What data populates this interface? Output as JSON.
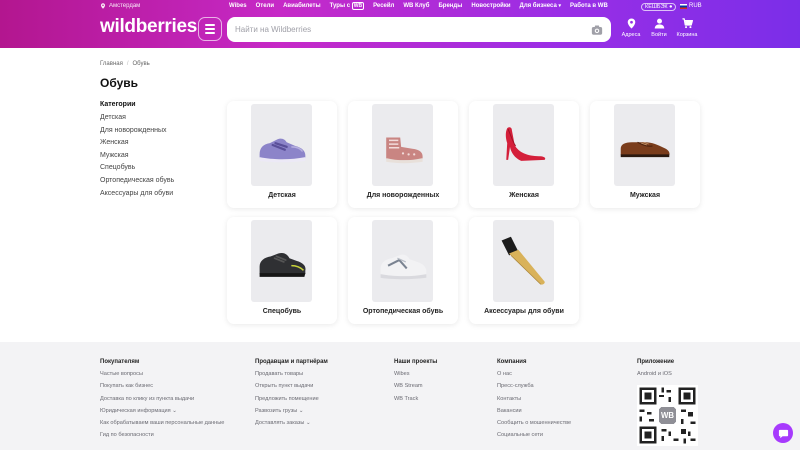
{
  "header": {
    "location": "Амстердам",
    "nav": [
      "Wibes",
      "Отели",
      "Авиабилеты",
      "Туры с ",
      "Ресейл",
      "WB Клуб",
      "Бренды",
      "Новостройки",
      "Для бизнеса",
      "Работа в WB"
    ],
    "tours_badge": "WB",
    "cashback": "КЕШБЭК",
    "currency": "RUB",
    "logo": "wildberries",
    "search_placeholder": "Найти на Wildberries",
    "icons": [
      {
        "label": "Адреса",
        "icon": "location-pin-icon"
      },
      {
        "label": "Войти",
        "icon": "user-icon"
      },
      {
        "label": "Корзина",
        "icon": "cart-icon"
      }
    ],
    "colors": {
      "gradient_start": "#b3168f",
      "gradient_mid": "#c629c7",
      "gradient_end": "#7b2ee8"
    }
  },
  "breadcrumb": [
    "Главная",
    "Обувь"
  ],
  "page_title": "Обувь",
  "sidebar": {
    "title": "Категории",
    "items": [
      "Детская",
      "Для новорожденных",
      "Женская",
      "Мужская",
      "Спецобувь",
      "Ортопедическая обувь",
      "Аксессуары для обуви"
    ]
  },
  "categories": [
    {
      "label": "Детская",
      "image": "kids-sneaker"
    },
    {
      "label": "Для новорожденных",
      "image": "newborn-shoe"
    },
    {
      "label": "Женская",
      "image": "red-heel"
    },
    {
      "label": "Мужская",
      "image": "brown-oxford"
    },
    {
      "label": "Спецобувь",
      "image": "safety-boot"
    },
    {
      "label": "Ортопедическая обувь",
      "image": "white-sneaker"
    },
    {
      "label": "Аксессуары для обуви",
      "image": "shoe-brush"
    }
  ],
  "footer": {
    "columns": [
      {
        "title": "Покупателям",
        "items": [
          "Частые вопросы",
          "Покупать как бизнес",
          "Доставка по клику из пункта выдачи",
          "Юридическая информация",
          "Как обрабатываем ваши персональные данные",
          "Гид по безопасности"
        ]
      },
      {
        "title": "Продавцам и партнёрам",
        "items": [
          "Продавать товары",
          "Открыть пункт выдачи",
          "Предложить помещение",
          "Развозить грузы",
          "Доставлять заказы"
        ]
      },
      {
        "title": "Наши проекты",
        "items": [
          "Wibes",
          "WB Stream",
          "WB Track"
        ]
      },
      {
        "title": "Компания",
        "items": [
          "О нас",
          "Пресс-служба",
          "Контакты",
          "Вакансии",
          "Сообщить о мошенничестве",
          "Социальные сети"
        ]
      },
      {
        "title": "Приложение",
        "items": [
          "Android и iOS"
        ]
      }
    ],
    "qr_center": "WB"
  }
}
